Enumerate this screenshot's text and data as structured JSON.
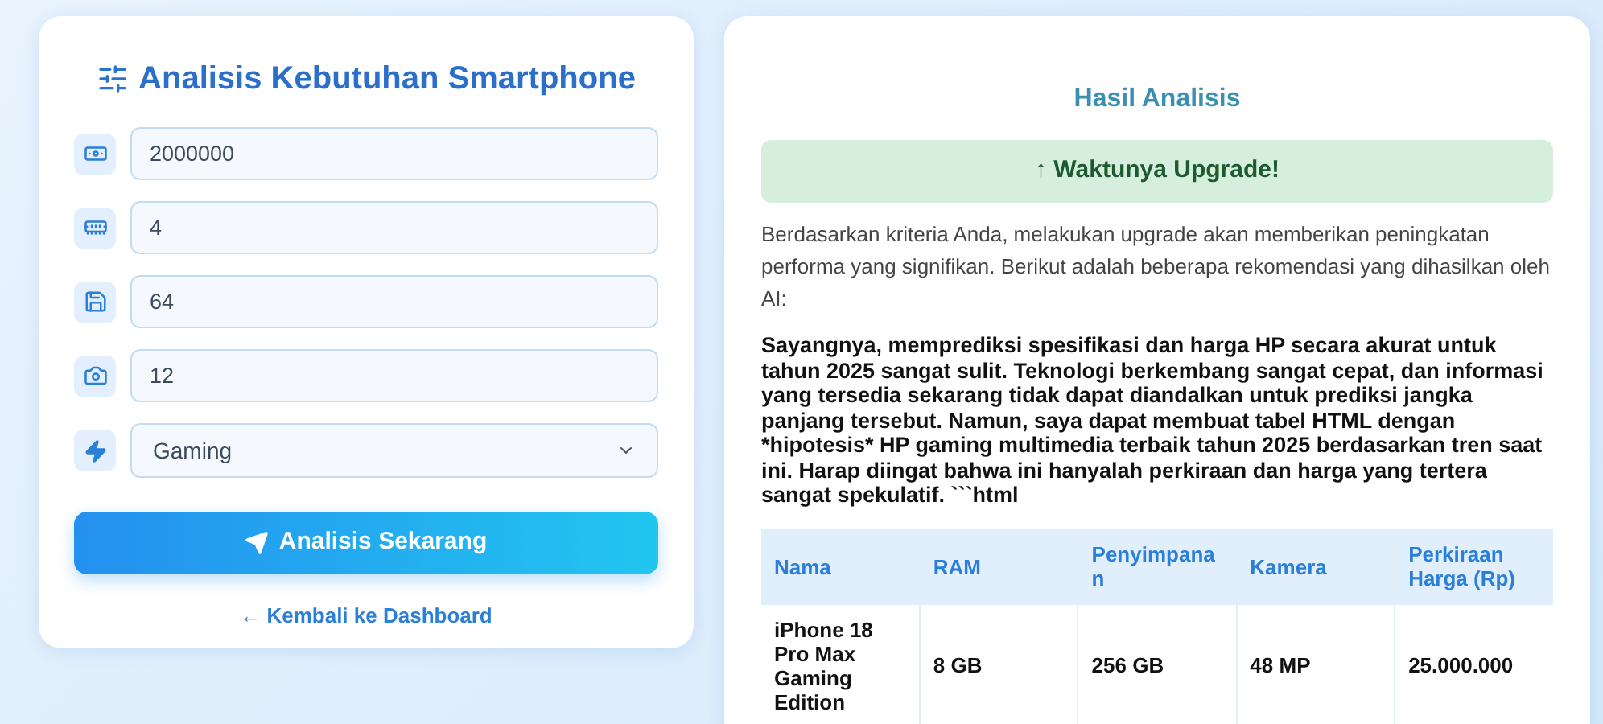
{
  "form": {
    "title": "Analisis Kebutuhan Smartphone",
    "fields": [
      {
        "kind": "input",
        "value": "2000000"
      },
      {
        "kind": "input",
        "value": "4"
      },
      {
        "kind": "input",
        "value": "64"
      },
      {
        "kind": "input",
        "value": "12"
      },
      {
        "kind": "select",
        "value": "Gaming"
      }
    ],
    "submit": "Analisis Sekarang",
    "back_link": "← Kembali ke Dashboard"
  },
  "result": {
    "title": "Hasil Analisis",
    "banner": "↑ Waktunya Upgrade!",
    "intro": "Berdasarkan kriteria Anda, melakukan upgrade akan memberikan peningkatan performa yang signifikan. Berikut adalah beberapa rekomendasi yang dihasilkan oleh AI:",
    "ai_text": "Sayangnya, memprediksi spesifikasi dan harga HP secara akurat untuk tahun 2025 sangat sulit. Teknologi berkembang sangat cepat, dan informasi yang tersedia sekarang tidak dapat diandalkan untuk prediksi jangka panjang tersebut. Namun, saya dapat membuat tabel HTML dengan *hipotesis* HP gaming multimedia terbaik tahun 2025 berdasarkan tren saat ini. Harap diingat bahwa ini hanyalah perkiraan dan harga yang tertera sangat spekulatif. ```html",
    "table": {
      "columns": [
        "Nama",
        "RAM",
        "Penyimpanan",
        "Kamera",
        "Perkiraan Harga (Rp)"
      ],
      "rows": [
        [
          "iPhone 18 Pro Max Gaming Edition",
          "8 GB",
          "256 GB",
          "48 MP",
          "25.000.000"
        ]
      ]
    }
  }
}
